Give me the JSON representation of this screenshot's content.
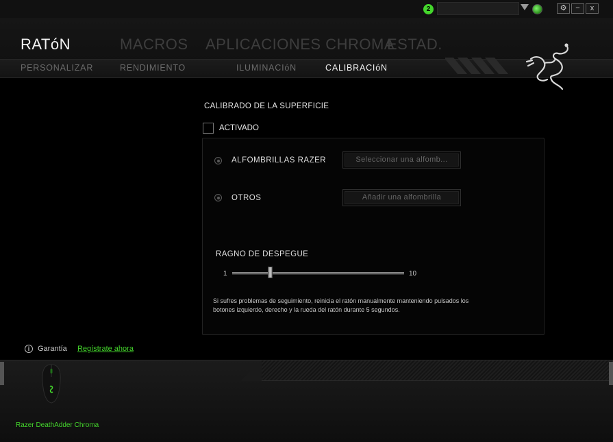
{
  "titlebar": {
    "notification_count": "2",
    "user_value": "",
    "buttons": {
      "settings": "⚙",
      "minimize": "−",
      "close": "x"
    }
  },
  "nav": {
    "main_tabs": [
      {
        "label": "RATóN",
        "active": true
      },
      {
        "label": "MACROS",
        "active": false
      },
      {
        "label": "APLICACIONES CHROMA",
        "active": false
      },
      {
        "label": "ESTAD.",
        "active": false
      }
    ],
    "sub_tabs": [
      {
        "label": "PERSONALIZAR",
        "active": false
      },
      {
        "label": "RENDIMIENTO",
        "active": false
      },
      {
        "label": "ILUMINACIóN",
        "active": false
      },
      {
        "label": "CALIBRACIóN",
        "active": true
      }
    ]
  },
  "calibration": {
    "section_title": "CALIBRADO DE LA SUPERFICIE",
    "enabled_label": "ACTIVADO",
    "enabled": false,
    "options": [
      {
        "label": "ALFOMBRILLAS RAZER",
        "button": "Seleccionar una alfomb..."
      },
      {
        "label": "OTROS",
        "button": "Añadir una alfombrilla"
      }
    ],
    "lift_range": {
      "title": "RAGNO DE DESPEGUE",
      "min": "1",
      "max": "10",
      "value": 3
    },
    "help_text": "Si sufres problemas de seguimiento, reinicia el ratón manualmente manteniendo pulsados los botones izquierdo, derecho y la rueda del ratón durante 5 segundos."
  },
  "footer": {
    "warranty_label": "Garantía",
    "register_link": "Regístrate ahora",
    "device_name": "Razer DeathAdder Chroma"
  },
  "colors": {
    "accent": "#44d62c",
    "background": "#000000",
    "inactive_tab": "#3d3d3d"
  },
  "icons": {
    "info": "info-icon",
    "logo": "razer-logo",
    "status": "online-status-icon"
  }
}
